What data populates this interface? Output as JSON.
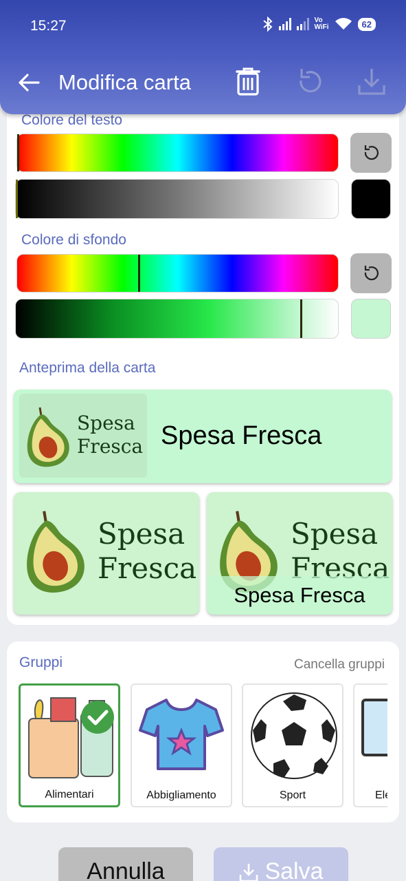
{
  "status_bar": {
    "time": "15:27",
    "vowifi_top": "Vo",
    "vowifi_bottom": "WiFi",
    "battery": "62"
  },
  "app_bar": {
    "title": "Modifica carta"
  },
  "text_color": {
    "label": "Colore del testo",
    "swatch_color": "#000000"
  },
  "bg_color": {
    "label": "Colore di sfondo",
    "swatch_color": "#c4f7d2"
  },
  "preview": {
    "label": "Anteprima della carta",
    "logo_line1": "Spesa",
    "logo_line2": "Fresca",
    "card_title": "Spesa Fresca",
    "background": "#c3f8d2"
  },
  "groups": {
    "label": "Gruppi",
    "clear_label": "Cancella gruppi",
    "items": [
      {
        "label": "Alimentari",
        "selected": true
      },
      {
        "label": "Abbigliamento",
        "selected": false
      },
      {
        "label": "Sport",
        "selected": false
      },
      {
        "label": "Ele",
        "selected": false
      }
    ]
  },
  "actions": {
    "cancel": "Annulla",
    "save": "Salva"
  },
  "colors": {
    "accent": "#4c5dc2",
    "section_label": "#5a6bbd",
    "selected_border": "#43a047"
  }
}
